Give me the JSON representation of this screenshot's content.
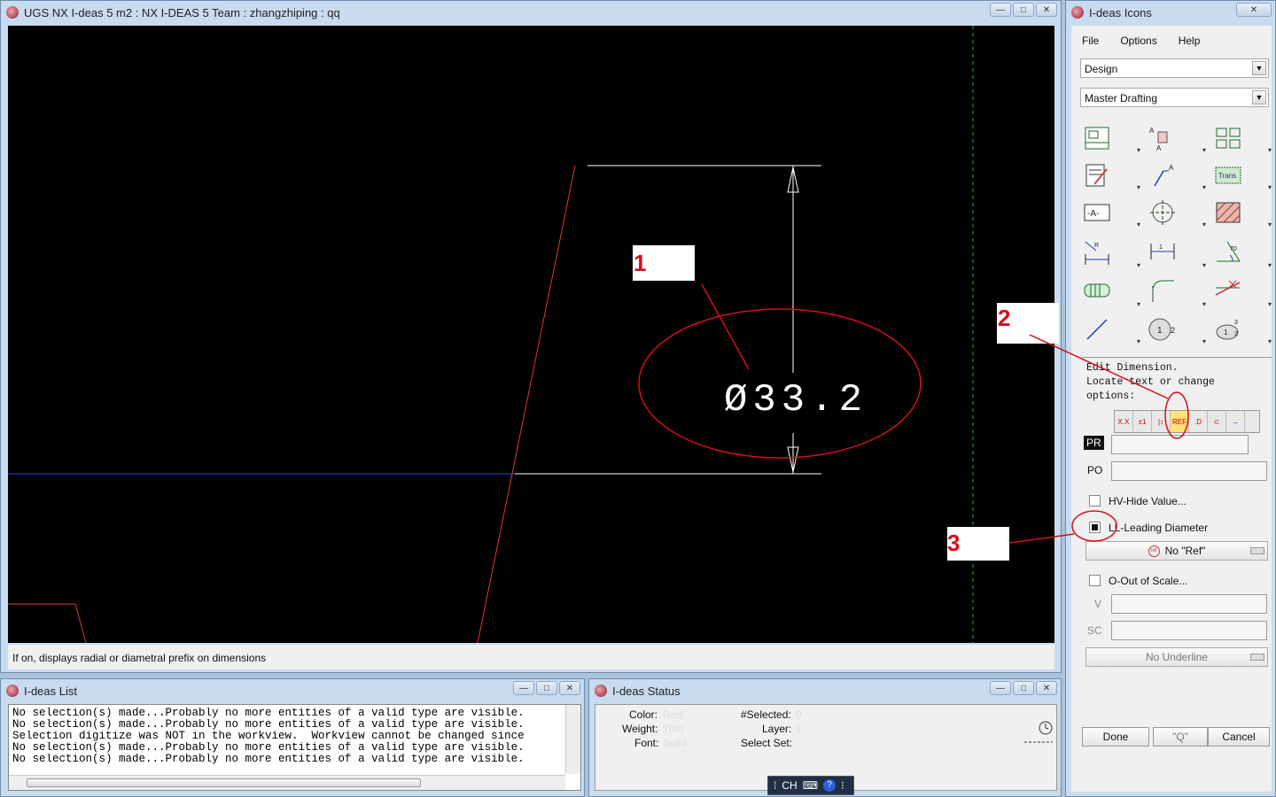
{
  "main": {
    "title": "UGS NX I-deas 5 m2 :    NX I-DEAS 5 Team : zhangzhiping : qq",
    "dimension_text": "Ø33.2",
    "status_message": "If on, displays radial or diametral prefix on dimensions"
  },
  "list": {
    "title": "I-deas List",
    "lines": [
      "No selection(s) made...Probably no more entities of a valid type are visible.",
      "No selection(s) made...Probably no more entities of a valid type are visible.",
      "Selection digitize was NOT in the workview.  Workview cannot be changed since",
      "No selection(s) made...Probably no more entities of a valid type are visible.",
      "No selection(s) made...Probably no more entities of a valid type are visible."
    ]
  },
  "status": {
    "title": "I-deas Status",
    "color_label": "Color:",
    "color_value": "Red",
    "weight_label": "Weight:",
    "weight_value": "Thin",
    "font_label": "Font:",
    "font_value": "Solid",
    "selected_label": "#Selected:",
    "selected_value": "0",
    "layer_label": "Layer:",
    "layer_value": "1",
    "selectset_label": "Select Set:"
  },
  "ime": {
    "lang": "CH"
  },
  "icons": {
    "title": "I-deas Icons",
    "menu": [
      "File",
      "Options",
      "Help"
    ],
    "task": "Design",
    "app": "Master Drafting",
    "prompt": "Edit Dimension.\nLocate text or change\noptions:",
    "opt_buttons": [
      "X.X",
      "±1",
      "|↕",
      "REF",
      ".D",
      "⊂",
      "→"
    ],
    "pr_label": "PR",
    "po_label": "PO",
    "hide_value": "HV-Hide Value...",
    "leading_diameter": "LL-Leading Diameter",
    "no_ref": "No \"Ref\"",
    "out_of_scale": "O-Out of Scale...",
    "v_label": "V",
    "sc_label": "SC",
    "underline": "No Underline",
    "done": "Done",
    "q": "\"Q\"",
    "cancel": "Cancel",
    "trans_label": "Trans",
    "datum_label": "-A-"
  },
  "annotations": [
    "1",
    "2",
    "3"
  ],
  "colors": {
    "accent_red": "#d3101a",
    "canvas": "#000000"
  }
}
